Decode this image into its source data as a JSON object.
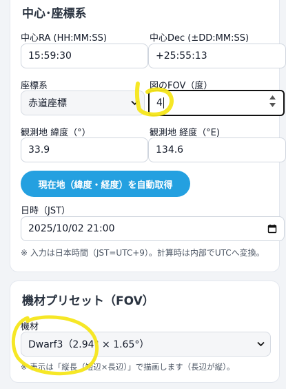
{
  "center": {
    "title": "中心･座標系",
    "ra_label": "中心RA (HH:MM:SS)",
    "ra_value": "15:59:30",
    "dec_label": "中心Dec (±DD:MM:SS)",
    "dec_value": "+25:55:13",
    "coord_label": "座標系",
    "coord_value": "赤道座標",
    "fov_label": "図のFOV（度）",
    "fov_value": "4",
    "lat_label": "観測地 緯度（°）",
    "lat_value": "33.9",
    "lon_label": "観測地 経度（°E)",
    "lon_value": "134.6",
    "auto_button": "現在地（緯度・経度）を自動取得",
    "datetime_label": "日時（JST）",
    "datetime_value": "2025/10/02 21:00",
    "note": "※ 入力は日本時間（JST=UTC+9）。計算時は内部でUTCへ変換。"
  },
  "preset": {
    "title": "機材プリセット（FOV）",
    "equip_label": "機材",
    "equip_value": "Dwarf3（2.94° × 1.65°）",
    "note": "※ 表示は「縦長（短辺×長辺）」で描画します（長辺が縦）。"
  },
  "colors": {
    "accent": "#24a0e0",
    "highlight": "#f5e61a"
  }
}
